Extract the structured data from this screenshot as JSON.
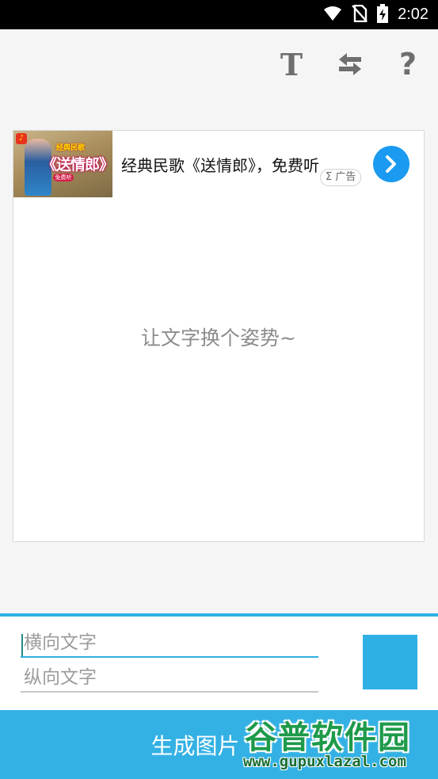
{
  "status_bar": {
    "time": "2:02",
    "icons": [
      "wifi-icon",
      "no-sim-icon",
      "battery-charging-icon"
    ]
  },
  "toolbar": {
    "text_button_label": "T",
    "swap_icon": "swap-arrows-icon",
    "help_button_label": "?"
  },
  "ad": {
    "thumb_big_text": "《送情郎》",
    "thumb_small_text": "经典民歌",
    "thumb_pill_text": "免费听",
    "title": "经典民歌《送情郎》，免费听",
    "badge": "Σ 广告",
    "go_icon": "chevron-right-icon"
  },
  "preview": {
    "placeholder": "让文字换个姿势~"
  },
  "inputs": {
    "horizontal_placeholder": "横向文字",
    "vertical_placeholder": "纵向文字"
  },
  "color_swatch": "#2fb0e5",
  "generate_button": "生成图片",
  "watermark": {
    "main": "谷普软件园",
    "url": "www.gupuxlazal.com"
  },
  "colors": {
    "accent": "#2fb0e5",
    "status_bar": "#000000",
    "background": "#f5f5f5"
  }
}
